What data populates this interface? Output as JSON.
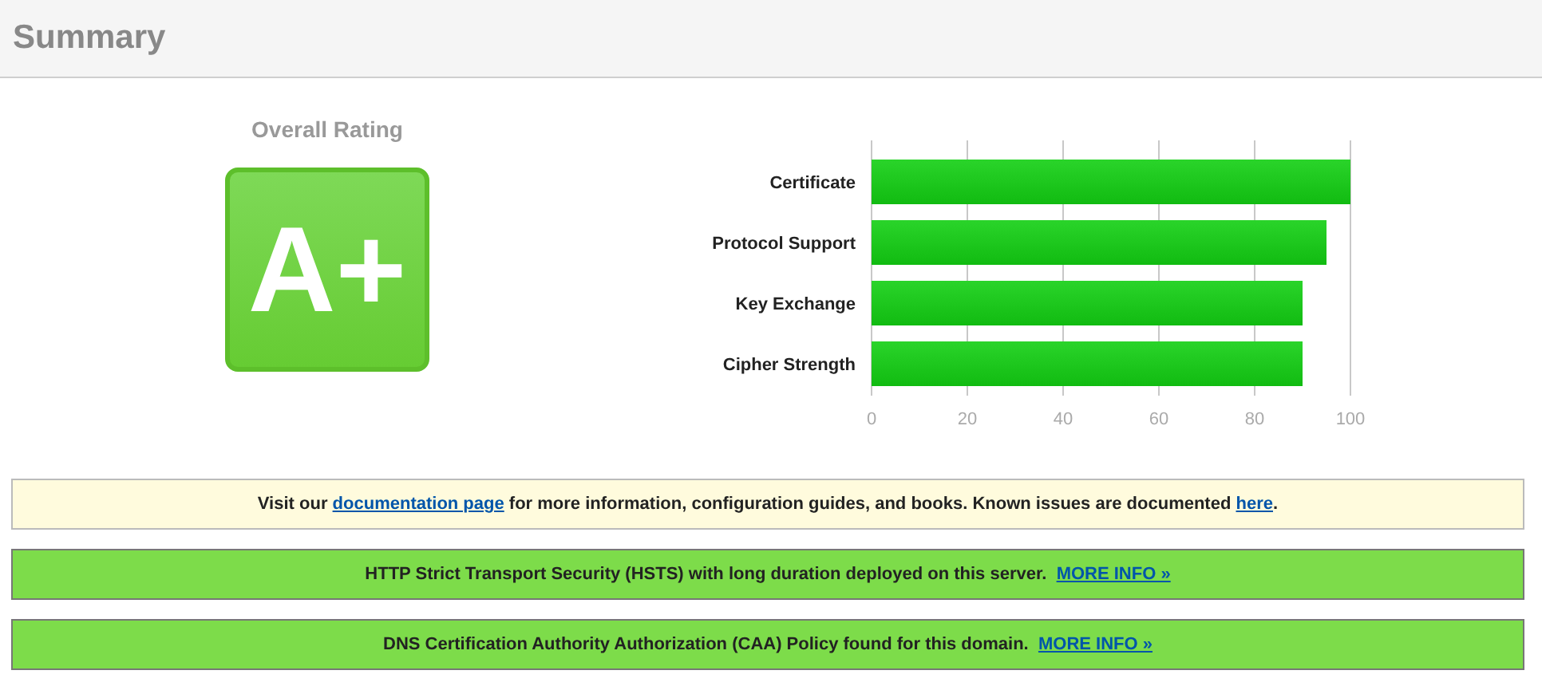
{
  "header": {
    "title": "Summary"
  },
  "rating": {
    "label": "Overall Rating",
    "grade": "A+"
  },
  "chart_data": {
    "type": "bar",
    "orientation": "horizontal",
    "categories": [
      "Certificate",
      "Protocol Support",
      "Key Exchange",
      "Cipher Strength"
    ],
    "series": [
      {
        "color": "#11bb11",
        "values": [
          100,
          95,
          90,
          90
        ]
      }
    ],
    "grid": true,
    "xlim": [
      0,
      100
    ],
    "xticks": [
      0,
      20,
      40,
      60,
      80,
      100
    ]
  },
  "notices": [
    {
      "kind": "info",
      "parts": [
        {
          "kind": "text",
          "text": "Visit our "
        },
        {
          "kind": "link",
          "text": "documentation page"
        },
        {
          "kind": "text",
          "text": " for more information, configuration guides, and books. Known issues are documented "
        },
        {
          "kind": "link",
          "text": "here"
        },
        {
          "kind": "text",
          "text": "."
        }
      ]
    },
    {
      "kind": "success",
      "parts": [
        {
          "kind": "text",
          "text": "HTTP Strict Transport Security (HSTS) with long duration deployed on this server.  "
        },
        {
          "kind": "link",
          "text": "MORE INFO »"
        }
      ]
    },
    {
      "kind": "success",
      "parts": [
        {
          "kind": "text",
          "text": "DNS Certification Authority Authorization (CAA) Policy found for this domain.  "
        },
        {
          "kind": "link",
          "text": "MORE INFO »"
        }
      ]
    }
  ]
}
